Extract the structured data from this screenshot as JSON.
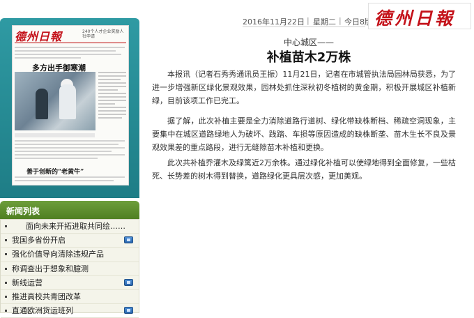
{
  "header": {
    "date": "2016年11月22日",
    "weekday": "星期二",
    "edition": "今日8版",
    "brand_logo": "德州日報"
  },
  "thumbnail": {
    "masthead": "德州日報",
    "header_text": "240个人才企业奖励人社申请",
    "main_headline": "多方出手御寒潮",
    "bottom_headline": "善于创新的“老黄牛”"
  },
  "news_list": {
    "title": "新闻列表",
    "items": [
      {
        "label": "面向未来开拓进取共同绘……",
        "has_video": false
      },
      {
        "label": "我国多省份开启",
        "has_video": true
      },
      {
        "label": "强化价值导向清除违规产品",
        "has_video": false
      },
      {
        "label": "称调查出于想象和臆测",
        "has_video": false
      },
      {
        "label": "新线运营",
        "has_video": true
      },
      {
        "label": "推进高校共青团改革",
        "has_video": false
      },
      {
        "label": "直通欧洲货运班列",
        "has_video": true
      }
    ]
  },
  "article": {
    "subtitle": "中心城区——",
    "headline": "补植苗木2万株",
    "paragraphs": [
      "本报讯（记者石秀秀通讯员王振）11月21日，记者在市城管执法局园林局获悉，为了进一步增强新区绿化景观效果，园林处抓住深秋初冬植树的黄金期，积极开展城区补植新绿，目前该项工作已完工。",
      "据了解，此次补植主要是全力消除道路行道树、绿化带缺株断档、稀疏空洞现象，主要集中在城区道路绿地人为破坏、践踏、车损等原因造成的缺株断垄、苗木生长不良及景观效果差的重点路段，进行无缝隙苗木补植和更换。",
      "此次共补植乔灌木及绿篱近2万余株。通过绿化补植可以使绿地得到全面修复，一些枯死、长势差的树木得到替换，道路绿化更具层次感，更加美观。"
    ]
  }
}
